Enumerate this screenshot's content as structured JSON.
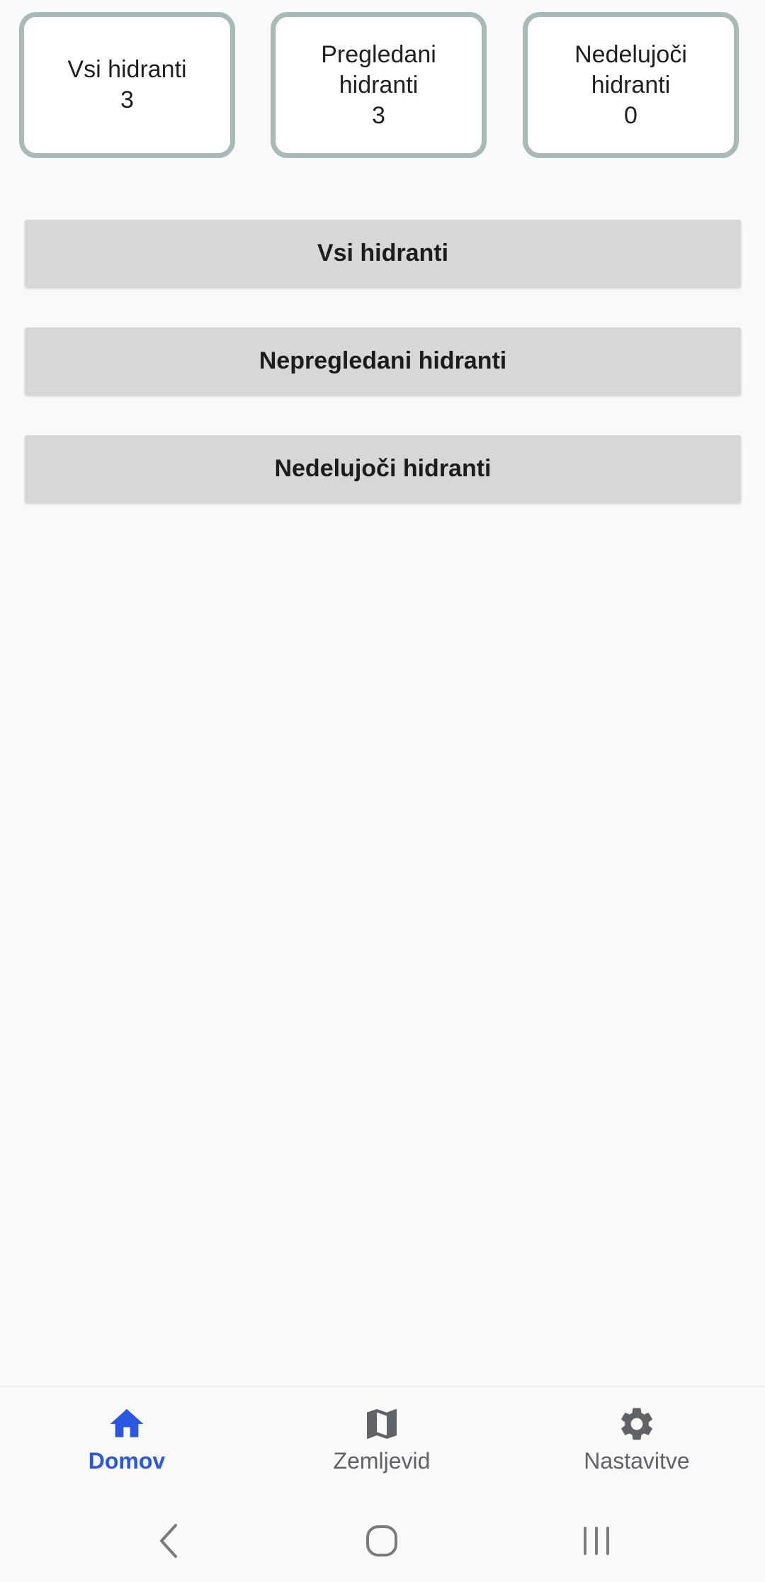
{
  "stats": [
    {
      "label_lines": [
        "Vsi hidranti"
      ],
      "value": "3"
    },
    {
      "label_lines": [
        "Pregledani",
        "hidranti"
      ],
      "value": "3"
    },
    {
      "label_lines": [
        "Nedelujoči",
        "hidranti"
      ],
      "value": "0"
    }
  ],
  "buttons": {
    "all": "Vsi hidranti",
    "unreviewed": "Nepregledani hidranti",
    "broken": "Nedelujoči hidranti"
  },
  "bottom_nav": {
    "items": [
      {
        "label": "Domov",
        "icon": "home-icon",
        "active": true
      },
      {
        "label": "Zemljevid",
        "icon": "map-icon",
        "active": false
      },
      {
        "label": "Nastavitve",
        "icon": "gear-icon",
        "active": false
      }
    ]
  },
  "system_nav": {
    "icons": [
      "back-icon",
      "home-circle-icon",
      "recents-icon"
    ]
  },
  "colors": {
    "accent": "#2a57e2",
    "inactive": "#5f6368",
    "card_border": "#a9b8b9",
    "button_bg": "#d6d7d7",
    "background": "#f9f9f9"
  }
}
